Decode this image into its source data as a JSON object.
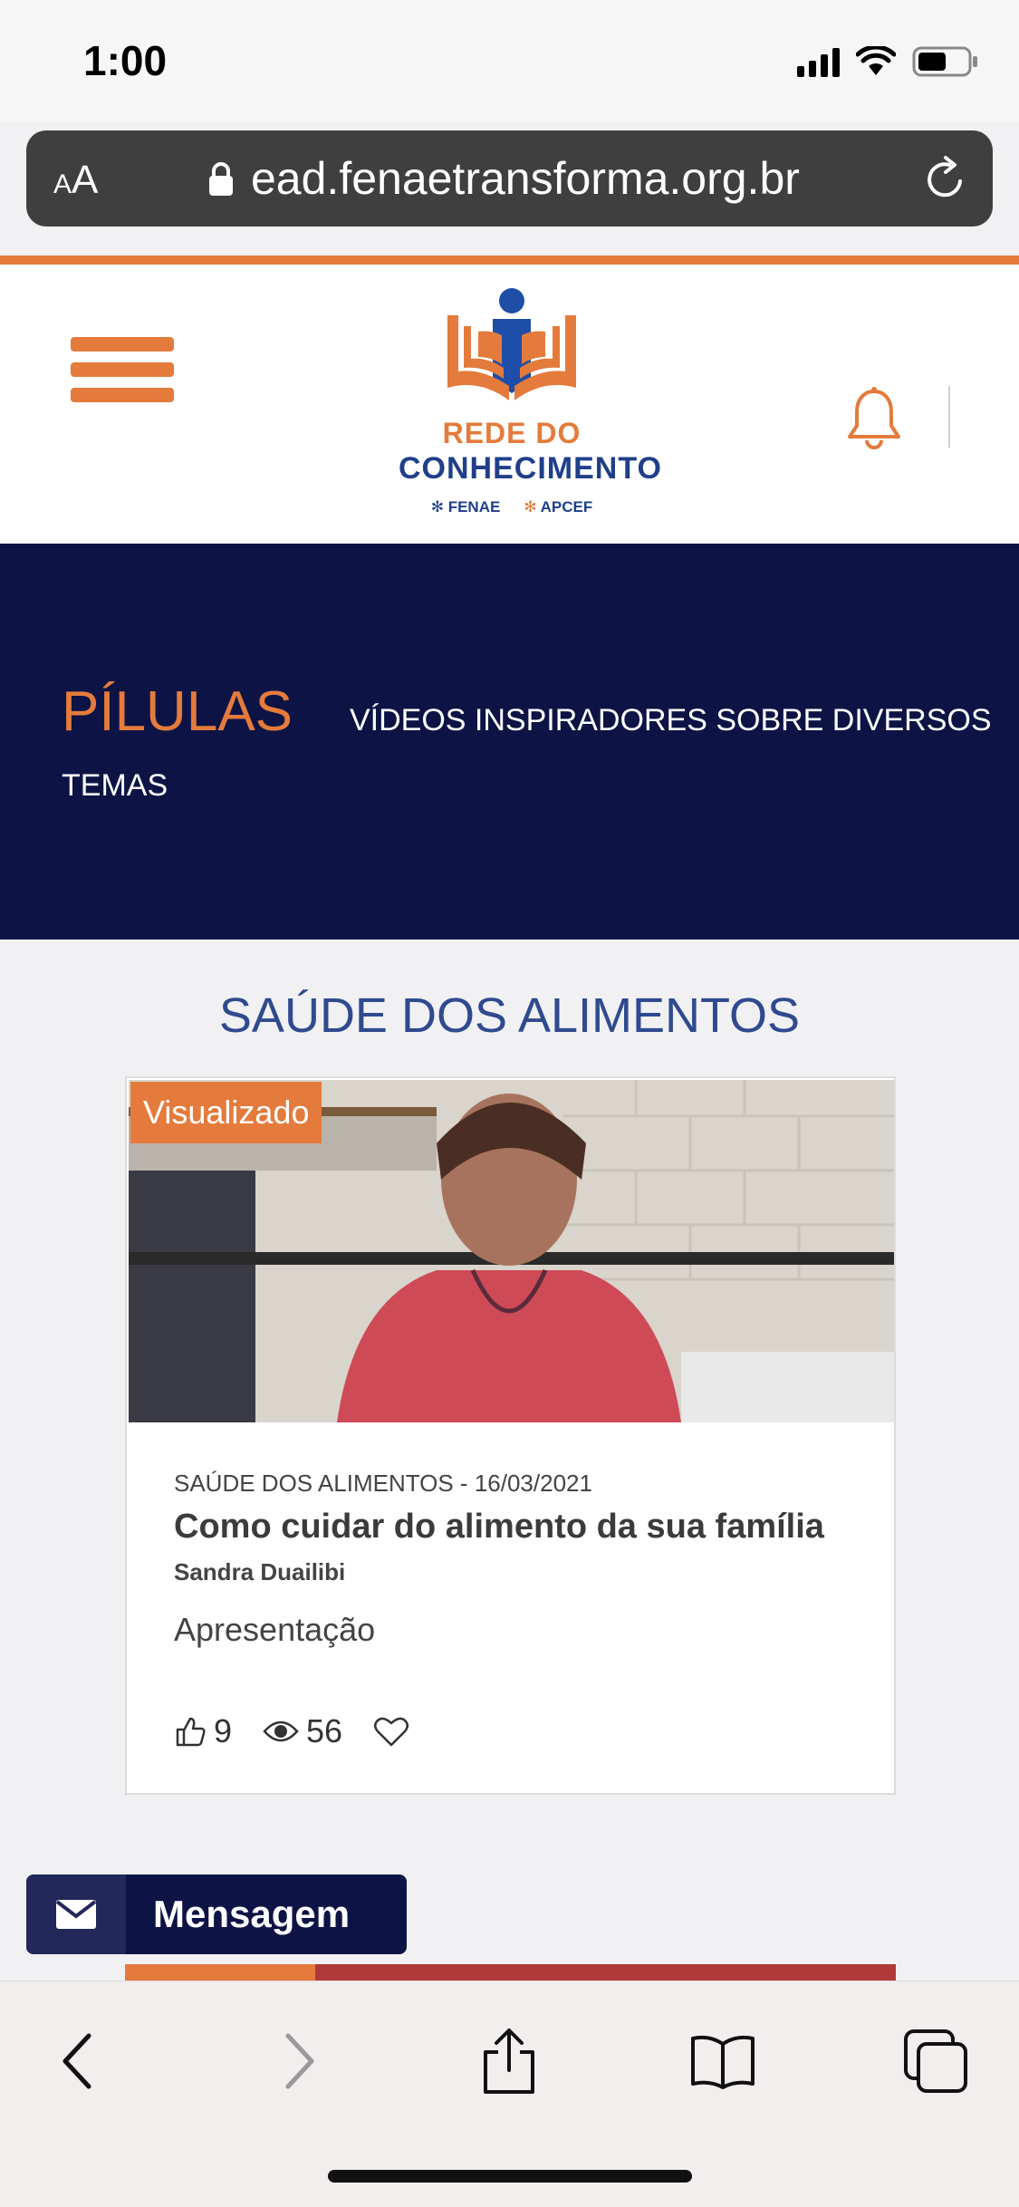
{
  "status_bar": {
    "time": "1:00"
  },
  "browser": {
    "text_size_small": "A",
    "text_size_big": "A",
    "url": "ead.fenaetransforma.org.br"
  },
  "header": {
    "logo_line1": "REDE DO",
    "logo_line2": "CONHECIMENTO",
    "partner1": "FENAE",
    "partner2": "APCEF"
  },
  "hero": {
    "title": "PÍLULAS",
    "subtitle_line1": "VÍDEOS INSPIRADORES SOBRE DIVERSOS",
    "subtitle_line2": "TEMAS"
  },
  "section": {
    "title": "SAÚDE DOS ALIMENTOS"
  },
  "card": {
    "badge": "Visualizado",
    "meta": "SAÚDE DOS ALIMENTOS - 16/03/2021",
    "title": "Como cuidar do alimento da sua família",
    "author": "Sandra Duailibi",
    "description": "Apresentação",
    "likes": "9",
    "views": "56"
  },
  "message_button": {
    "label": "Mensagem"
  },
  "colors": {
    "accent": "#e47b3c",
    "navy": "#0d1445",
    "section_title": "#2f4a8f"
  },
  "icons": [
    "hamburger-icon",
    "bell-icon",
    "lock-icon",
    "reload-icon",
    "like-icon",
    "eye-icon",
    "heart-icon",
    "envelope-icon",
    "back-icon",
    "forward-icon",
    "share-icon",
    "bookmarks-icon",
    "tabs-icon"
  ]
}
